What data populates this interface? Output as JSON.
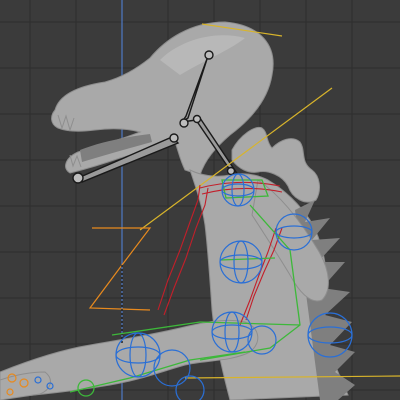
{
  "viewport": {
    "background": "#3b3b3b",
    "grid_color": "#2e2e2e",
    "z_axis_color": "#4d78c4"
  },
  "scene": {
    "mesh_color": "#a9a9a9",
    "armature_bone_color": "#9a9a9a",
    "controller_colors": {
      "yellow": "#d8b42b",
      "orange": "#e88a1e",
      "green": "#3db83a",
      "blue": "#2a6fd6",
      "red": "#c21f2a"
    },
    "icons": [
      "bone-icon",
      "joint-icon",
      "circle-controller-icon"
    ]
  }
}
